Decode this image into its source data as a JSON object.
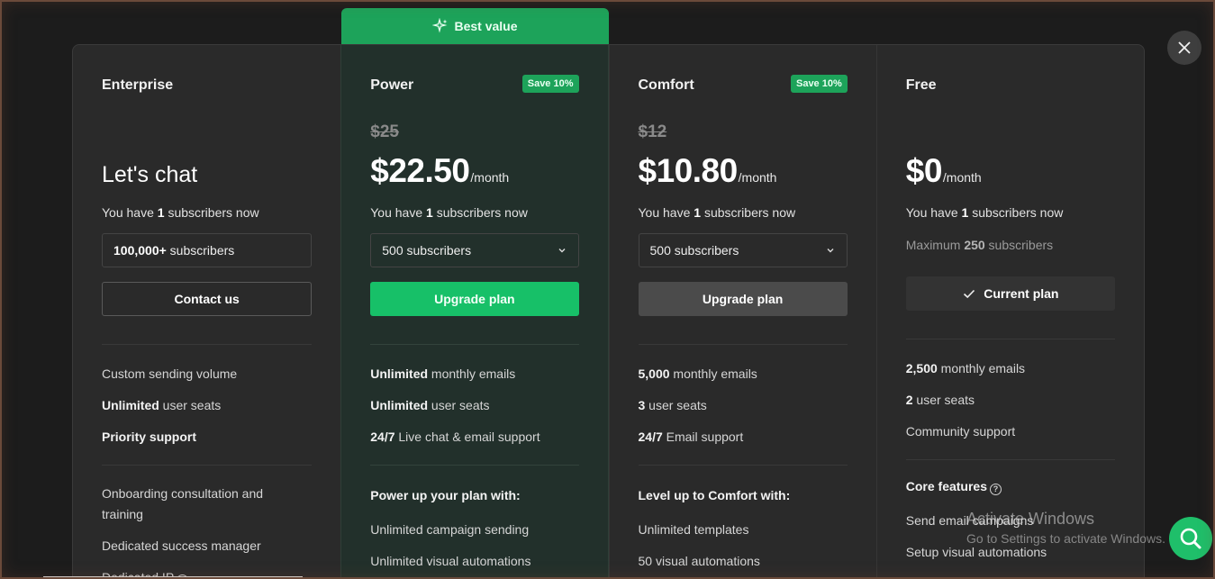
{
  "banner": {
    "label": "Best value"
  },
  "plans": {
    "enterprise": {
      "name": "Enterprise",
      "headline": "Let's chat",
      "have_prefix": "You have ",
      "have_count": "1",
      "have_suffix": " subscribers now",
      "subscribers_bold": "100,000+",
      "subscribers_rest": " subscribers",
      "button": "Contact us",
      "features": [
        {
          "bold": "",
          "text": "Custom sending volume"
        },
        {
          "bold": "Unlimited",
          "text": " user seats"
        },
        {
          "bold": "Priority support",
          "text": ""
        }
      ],
      "extras": [
        "Onboarding consultation and",
        "training",
        "Dedicated success manager",
        "Dedicated IP"
      ]
    },
    "power": {
      "name": "Power",
      "badge": "Save 10%",
      "old_price": "$25",
      "price": "$22.50",
      "per": "/month",
      "have_prefix": "You have ",
      "have_count": "1",
      "have_suffix": " subscribers now",
      "select_value": "500 subscribers",
      "button": "Upgrade plan",
      "features": [
        {
          "bold": "Unlimited",
          "text": " monthly emails"
        },
        {
          "bold": "Unlimited",
          "text": " user seats"
        },
        {
          "bold": "24/7",
          "text": " Live chat & email support"
        }
      ],
      "section_title": "Power up your plan with:",
      "extras": [
        "Unlimited campaign sending",
        "Unlimited visual automations"
      ]
    },
    "comfort": {
      "name": "Comfort",
      "badge": "Save 10%",
      "old_price": "$12",
      "price": "$10.80",
      "per": "/month",
      "have_prefix": "You have ",
      "have_count": "1",
      "have_suffix": " subscribers now",
      "select_value": "500 subscribers",
      "button": "Upgrade plan",
      "features": [
        {
          "bold": "5,000",
          "text": " monthly emails"
        },
        {
          "bold": "3",
          "text": " user seats"
        },
        {
          "bold": "24/7",
          "text": " Email support"
        }
      ],
      "section_title": "Level up to Comfort with:",
      "extras": [
        "Unlimited templates",
        "50 visual automations"
      ]
    },
    "free": {
      "name": "Free",
      "price": "$0",
      "per": "/month",
      "have_prefix": "You have ",
      "have_count": "1",
      "have_suffix": " subscribers now",
      "max_prefix": "Maximum ",
      "max_count": "250",
      "max_suffix": " subscribers",
      "button": "Current plan",
      "features": [
        {
          "bold": "2,500",
          "text": " monthly emails"
        },
        {
          "bold": "2",
          "text": " user seats"
        },
        {
          "bold": "",
          "text": "Community support"
        }
      ],
      "section_title": "Core features",
      "extras": [
        "Send email campaigns",
        "Setup visual automations"
      ]
    }
  },
  "watermark": {
    "line1": "Activate Windows",
    "line2": "Go to Settings to activate Windows."
  },
  "colors": {
    "accent_green": "#17c068",
    "badge_green": "#1da35a",
    "panel": "#2a2a2a",
    "power_panel": "#22302b"
  }
}
